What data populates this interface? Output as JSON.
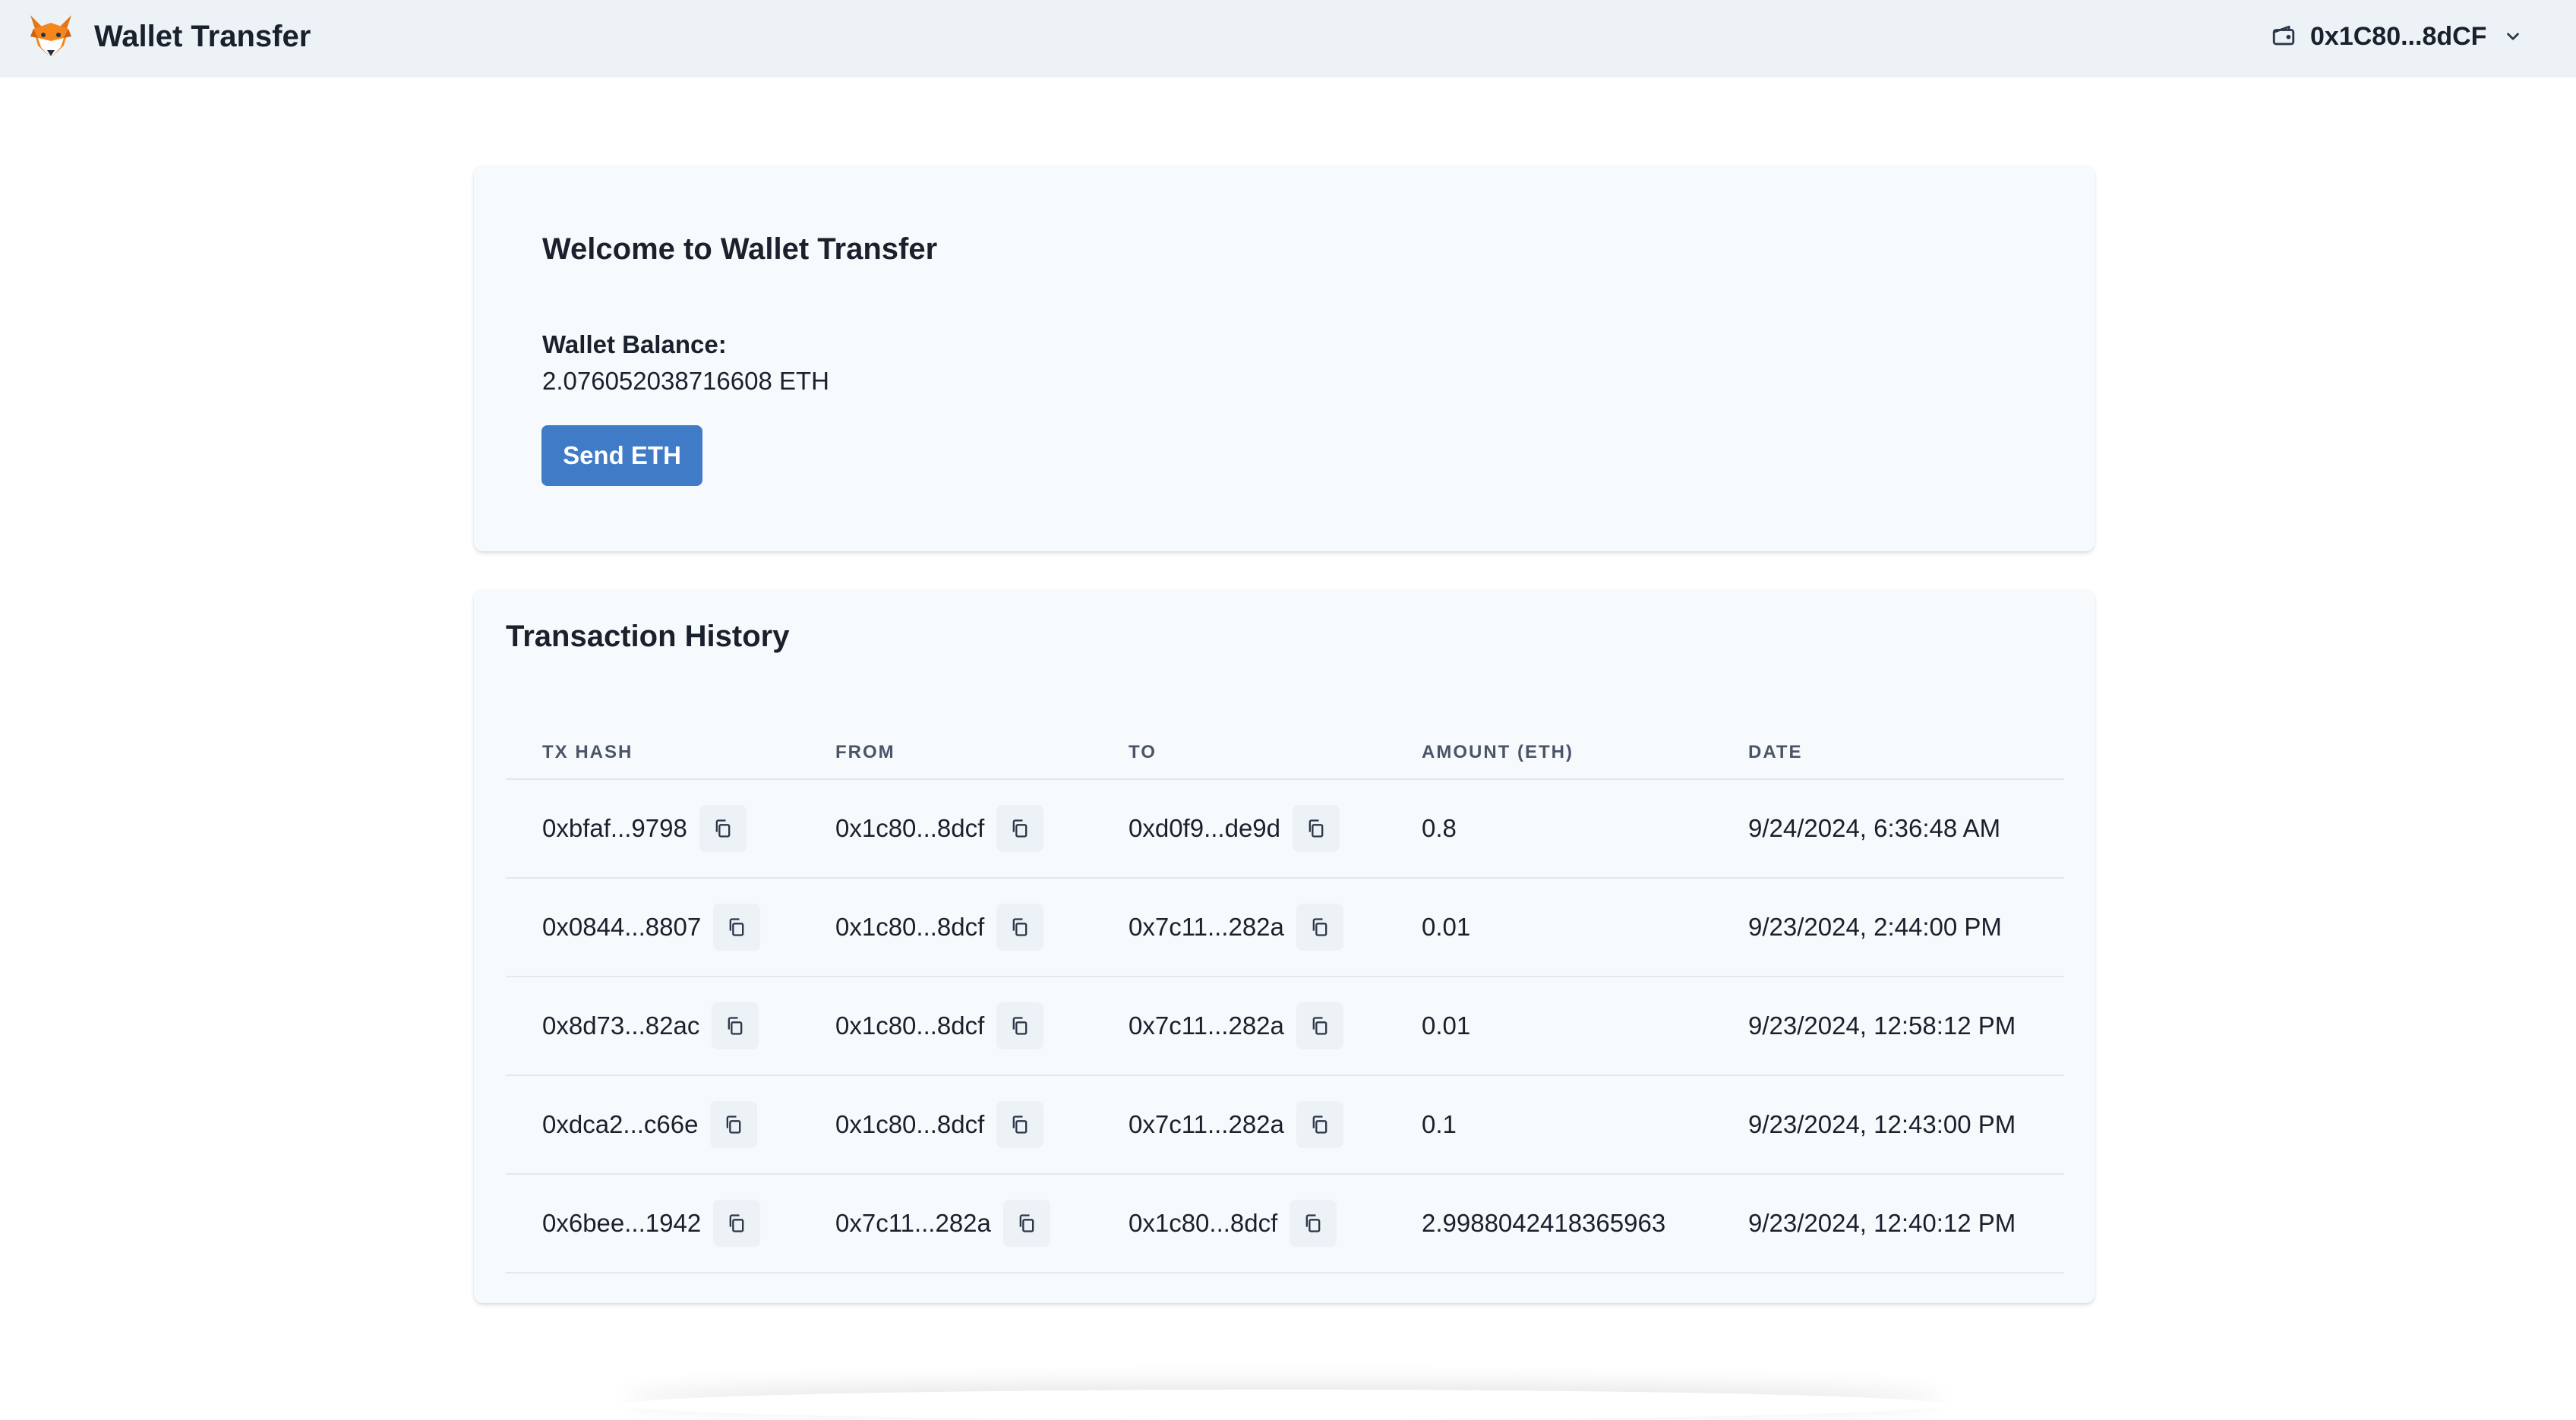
{
  "header": {
    "app_title": "Wallet Transfer",
    "logo_icon": "fox-logo-icon",
    "wallet_address": "0x1C80...8dCF",
    "wallet_icon": "wallet-icon",
    "dropdown_icon": "chevron-down-icon"
  },
  "welcome": {
    "title": "Welcome to Wallet Transfer",
    "balance_label": "Wallet Balance:",
    "balance_value": "2.076052038716608 ETH",
    "send_button": "Send ETH"
  },
  "history": {
    "title": "Transaction History",
    "columns": [
      "TX HASH",
      "FROM",
      "TO",
      "AMOUNT (ETH)",
      "DATE"
    ],
    "copy_icon": "copy-icon",
    "rows": [
      {
        "hash": "0xbfaf...9798",
        "from": "0x1c80...8dcf",
        "to": "0xd0f9...de9d",
        "amount": "0.8",
        "date": "9/24/2024, 6:36:48 AM"
      },
      {
        "hash": "0x0844...8807",
        "from": "0x1c80...8dcf",
        "to": "0x7c11...282a",
        "amount": "0.01",
        "date": "9/23/2024, 2:44:00 PM"
      },
      {
        "hash": "0x8d73...82ac",
        "from": "0x1c80...8dcf",
        "to": "0x7c11...282a",
        "amount": "0.01",
        "date": "9/23/2024, 12:58:12 PM"
      },
      {
        "hash": "0xdca2...c66e",
        "from": "0x1c80...8dcf",
        "to": "0x7c11...282a",
        "amount": "0.1",
        "date": "9/23/2024, 12:43:00 PM"
      },
      {
        "hash": "0x6bee...1942",
        "from": "0x7c11...282a",
        "to": "0x1c80...8dcf",
        "amount": "2.9988042418365963",
        "date": "9/23/2024, 12:40:12 PM"
      }
    ]
  },
  "colors": {
    "accent": "#3f7bc6",
    "header_bg": "#edf2f7",
    "card_bg": "#f7fafc"
  }
}
